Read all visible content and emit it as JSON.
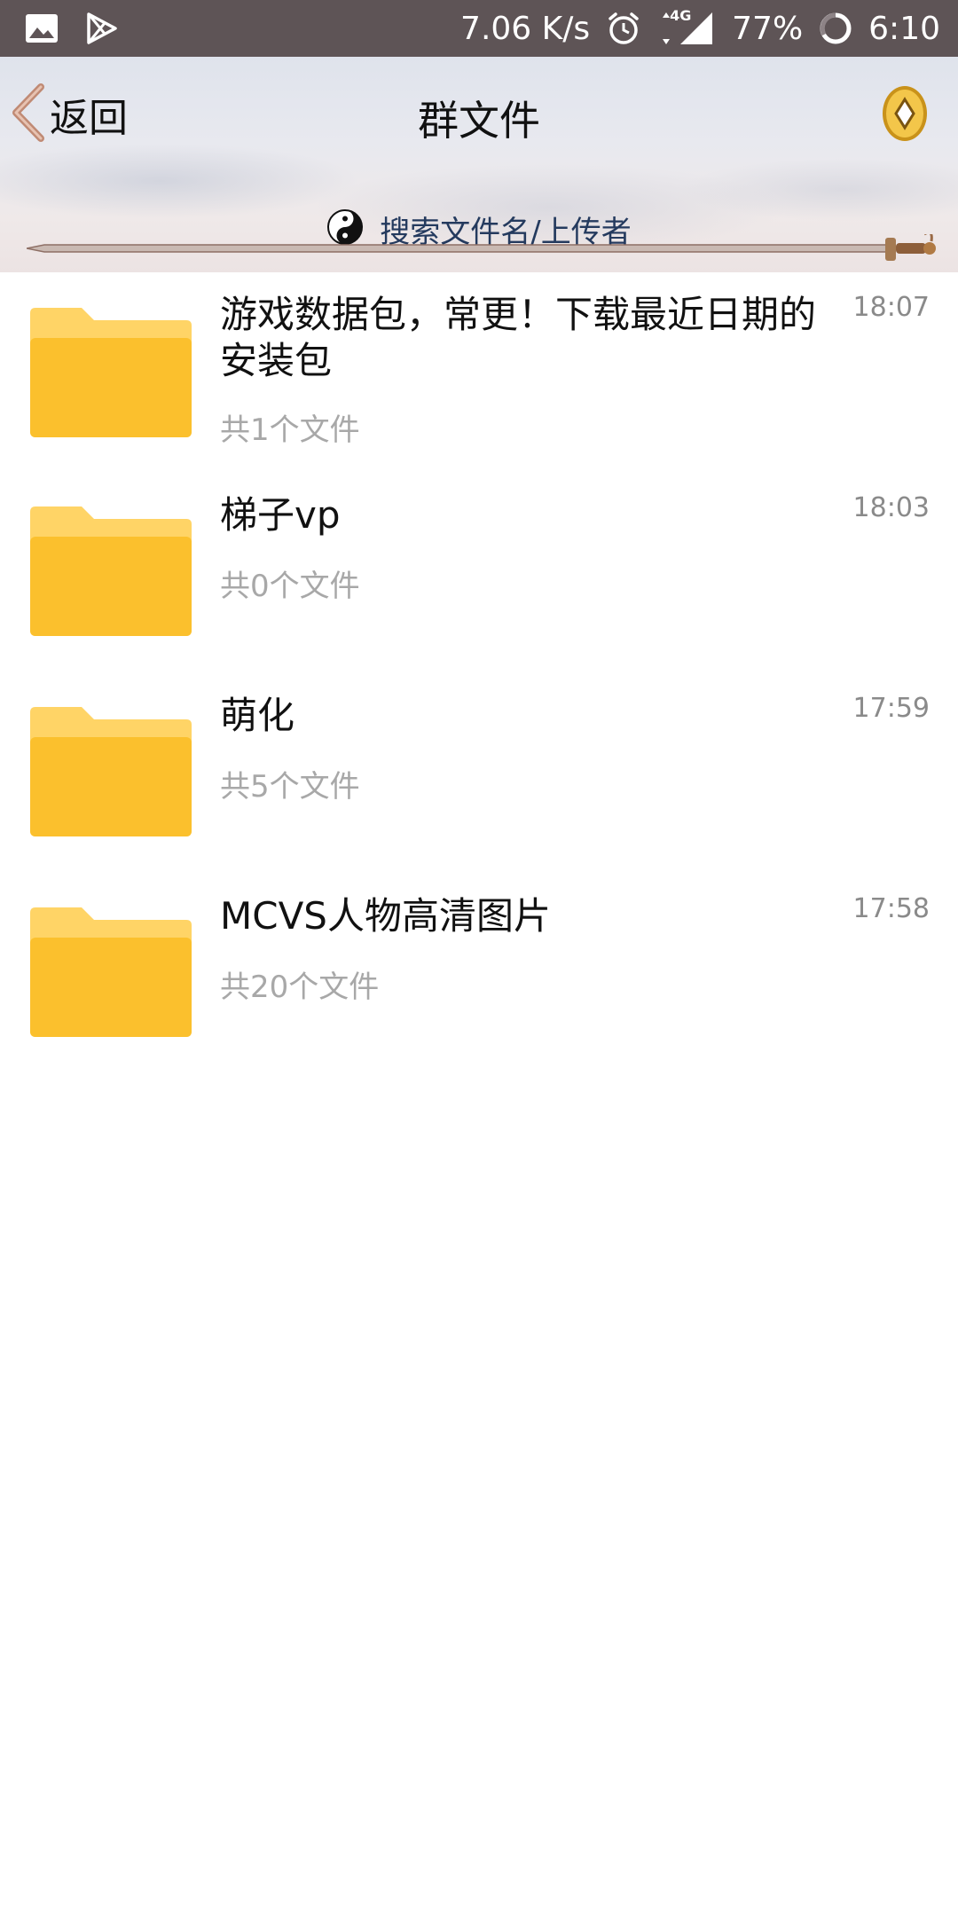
{
  "status_bar": {
    "net_speed": "7.06 K/s",
    "network": "4G",
    "battery": "77%",
    "time": "6:10"
  },
  "header": {
    "back_label": "返回",
    "title": "群文件",
    "search_placeholder": "搜索文件名/上传者"
  },
  "files": [
    {
      "name": "游戏数据包，常更！下载最近日期的安装包",
      "count": "共1个文件",
      "time": "18:07"
    },
    {
      "name": "梯子vp",
      "count": "共0个文件",
      "time": "18:03"
    },
    {
      "name": "萌化",
      "count": "共5个文件",
      "time": "17:59"
    },
    {
      "name": "MCVS人物高清图片",
      "count": "共20个文件",
      "time": "17:58"
    }
  ],
  "colors": {
    "status_bar_bg": "#5e5456",
    "folder": "#fbc02d",
    "folder_tab": "#ffd466",
    "search_text": "#243a5e"
  }
}
